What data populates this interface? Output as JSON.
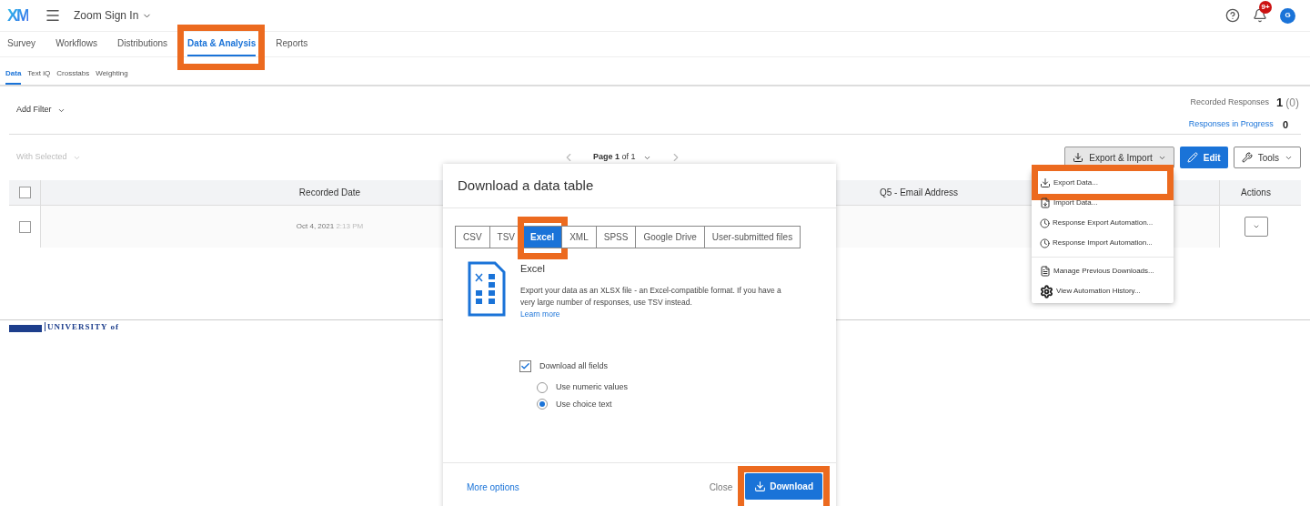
{
  "header": {
    "logo": "XM",
    "project": "Zoom Sign In",
    "notification_badge": "9+",
    "avatar": "G"
  },
  "nav_tabs": [
    {
      "label": "Survey",
      "selected": false,
      "highlighted": false
    },
    {
      "label": "Workflows",
      "selected": false,
      "highlighted": false
    },
    {
      "label": "Distributions",
      "selected": false,
      "highlighted": false
    },
    {
      "label": "Data & Analysis",
      "selected": true,
      "highlighted": true
    },
    {
      "label": "Reports",
      "selected": false,
      "highlighted": false
    }
  ],
  "sub_tabs": [
    {
      "label": "Data",
      "selected": true
    },
    {
      "label": "Text iQ",
      "selected": false
    },
    {
      "label": "Crosstabs",
      "selected": false
    },
    {
      "label": "Weighting",
      "selected": false
    }
  ],
  "filter": {
    "label": "Add Filter"
  },
  "stats": {
    "recorded_label": "Recorded Responses",
    "recorded_value": "1",
    "recorded_extra": "(0)",
    "in_progress_label": "Responses in Progress",
    "in_progress_value": "0"
  },
  "toolbar": {
    "with_selected": "With Selected",
    "page": "**Page 1** of 1",
    "buttons": [
      {
        "label": "Export & Import",
        "kind": "dropdown",
        "pressed": true
      },
      {
        "label": "Edit",
        "kind": "primary",
        "pressed": false
      },
      {
        "label": "Tools",
        "kind": "outline",
        "pressed": false
      }
    ]
  },
  "table": {
    "header_checked": false,
    "columns": [
      "Recorded Date",
      "Q5 - Email Address",
      "Actions"
    ],
    "rows": [
      {
        "checked": false,
        "recorded_date": "Oct 4, 2021",
        "recorded_time": "2:13 PM"
      }
    ]
  },
  "menu": {
    "items": [
      {
        "label": "Export Data...",
        "kind": "download",
        "divider_before": false,
        "highlighted": true
      },
      {
        "label": "Import Data...",
        "kind": "import",
        "divider_before": false,
        "highlighted": false
      },
      {
        "label": "Response Export Automation...",
        "kind": "clock",
        "divider_before": false,
        "highlighted": false
      },
      {
        "label": "Response Import Automation...",
        "kind": "clock",
        "divider_before": false,
        "highlighted": false
      },
      {
        "label": "Manage Previous Downloads...",
        "kind": "document",
        "divider_before": true,
        "highlighted": false
      },
      {
        "label": "View Automation History...",
        "kind": "gear",
        "divider_before": false,
        "highlighted": false
      }
    ]
  },
  "modal": {
    "title": "Download a data table",
    "formats": [
      {
        "label": "CSV",
        "selected": false,
        "highlighted": false
      },
      {
        "label": "TSV",
        "selected": false,
        "highlighted": false
      },
      {
        "label": "Excel",
        "selected": true,
        "highlighted": true
      },
      {
        "label": "XML",
        "selected": false,
        "highlighted": false
      },
      {
        "label": "SPSS",
        "selected": false,
        "highlighted": false
      },
      {
        "label": "Google Drive",
        "selected": false,
        "highlighted": false
      },
      {
        "label": "User-submitted files",
        "selected": false,
        "highlighted": false
      }
    ],
    "format_title": "Excel",
    "description": "Export your data as an XLSX file - an Excel-compatible format. If you have a very large number of responses, use TSV instead.",
    "learn_more": "Learn more",
    "download_all": {
      "label": "Download all fields",
      "checked": true
    },
    "options": [
      {
        "label": "Use numeric values",
        "selected": false
      },
      {
        "label": "Use choice text",
        "selected": true
      }
    ],
    "more_options": "More options",
    "close": "Close",
    "download": {
      "label": "Download",
      "highlighted": true
    }
  },
  "footer": {
    "logo_text": "UNIVERSITY of"
  }
}
